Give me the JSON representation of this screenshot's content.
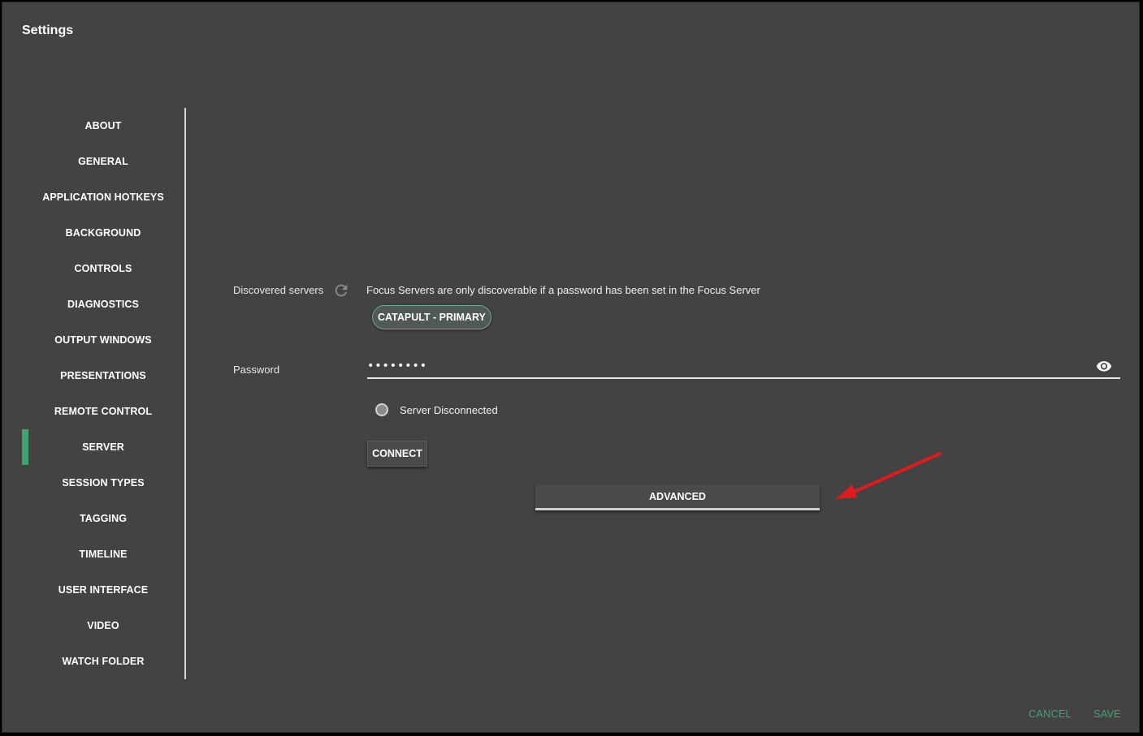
{
  "window": {
    "title": "Settings"
  },
  "sidebar": {
    "active_color": "#3fa274",
    "items": [
      {
        "label": "ABOUT"
      },
      {
        "label": "GENERAL"
      },
      {
        "label": "APPLICATION HOTKEYS"
      },
      {
        "label": "BACKGROUND"
      },
      {
        "label": "CONTROLS"
      },
      {
        "label": "DIAGNOSTICS"
      },
      {
        "label": "OUTPUT WINDOWS"
      },
      {
        "label": "PRESENTATIONS"
      },
      {
        "label": "REMOTE CONTROL"
      },
      {
        "label": "SERVER",
        "active": true
      },
      {
        "label": "SESSION TYPES"
      },
      {
        "label": "TAGGING"
      },
      {
        "label": "TIMELINE"
      },
      {
        "label": "USER INTERFACE"
      },
      {
        "label": "VIDEO"
      },
      {
        "label": "WATCH FOLDER"
      }
    ]
  },
  "server": {
    "discovered_label": "Discovered servers",
    "refresh_icon": "refresh-icon",
    "info_text": "Focus Servers are only discoverable if a password has been set in the Focus Server",
    "discovered_chip": "CATAPULT - PRIMARY",
    "password_label": "Password",
    "password_value": "••••••••",
    "show_password_icon": "eye-icon",
    "status_text": "Server Disconnected",
    "connect_label": "CONNECT",
    "advanced_label": "ADVANCED"
  },
  "footer": {
    "cancel_label": "CANCEL",
    "save_label": "SAVE",
    "accent": "#3fa274"
  },
  "annotation": {
    "arrow_color": "#e01b1b"
  }
}
